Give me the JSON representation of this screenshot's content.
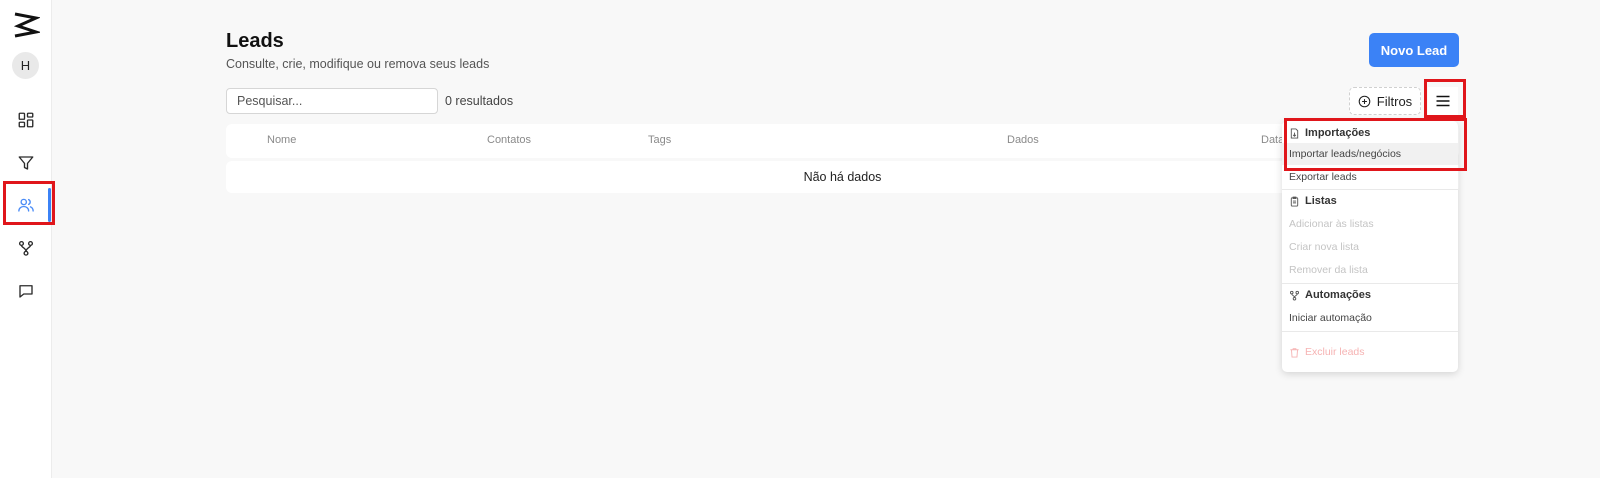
{
  "sidebar": {
    "avatar_initial": "H",
    "items": [
      {
        "icon": "dashboard-icon"
      },
      {
        "icon": "funnel-icon"
      },
      {
        "icon": "users-icon",
        "active": true
      },
      {
        "icon": "workflow-icon"
      },
      {
        "icon": "chat-icon"
      }
    ]
  },
  "header": {
    "title": "Leads",
    "subtitle": "Consulte, crie, modifique ou remova seus leads",
    "new_button": "Novo Lead"
  },
  "toolbar": {
    "search_placeholder": "Pesquisar...",
    "results": "0 resultados",
    "filters_label": "Filtros"
  },
  "table": {
    "columns": [
      "Nome",
      "Contatos",
      "Tags",
      "Dados",
      "Data"
    ],
    "empty_text": "Não há dados"
  },
  "menu": {
    "groups": [
      {
        "label": "Importações",
        "icon": "file-import-icon",
        "items": [
          {
            "label": "Importar leads/negócios",
            "state": "hover"
          },
          {
            "label": "Exportar leads",
            "state": "enabled"
          }
        ]
      },
      {
        "label": "Listas",
        "icon": "clipboard-icon",
        "items": [
          {
            "label": "Adicionar às listas",
            "state": "disabled"
          },
          {
            "label": "Criar nova lista",
            "state": "disabled"
          },
          {
            "label": "Remover da lista",
            "state": "disabled"
          }
        ]
      },
      {
        "label": "Automações",
        "icon": "workflow-icon",
        "items": [
          {
            "label": "Iniciar automação",
            "state": "enabled"
          }
        ]
      }
    ],
    "danger_item": {
      "label": "Excluir leads",
      "icon": "trash-icon",
      "state": "disabled"
    }
  },
  "colors": {
    "accent": "#3b82f6",
    "highlight": "#e0161b"
  }
}
